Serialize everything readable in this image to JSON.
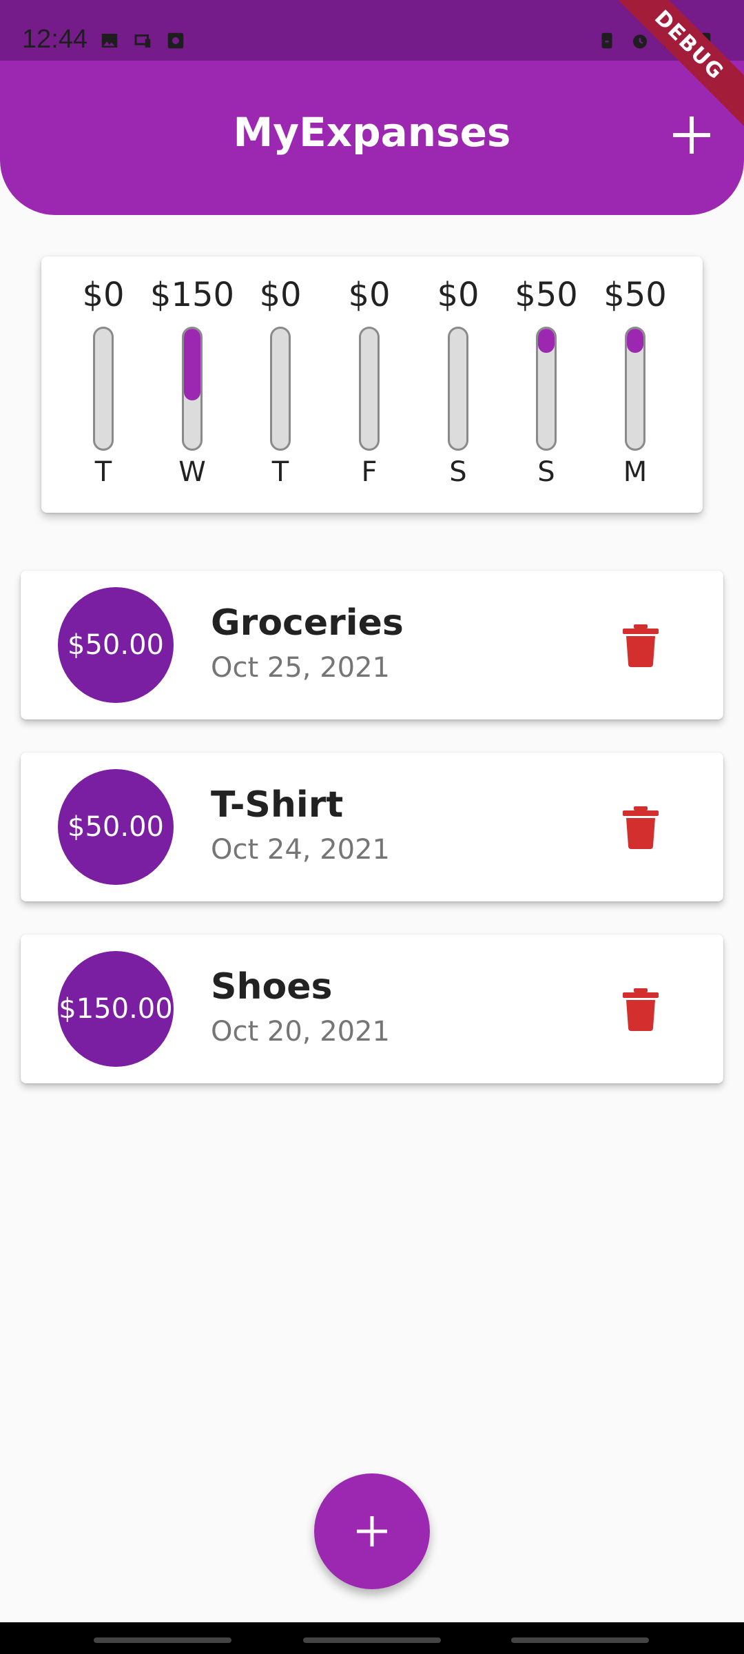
{
  "status_bar": {
    "time": "12:44",
    "left_icons": [
      "image-icon",
      "devices-icon",
      "media-icon"
    ],
    "right_icons": [
      "battery-saver-icon",
      "alarm-icon",
      "network-icon",
      "battery-icon"
    ],
    "debug_label": "DEBUG"
  },
  "app_bar": {
    "title": "MyExpanses",
    "add_icon": "plus-icon"
  },
  "chart": {
    "days": [
      {
        "day": "T",
        "amount": "$0",
        "fraction": 0
      },
      {
        "day": "W",
        "amount": "$150",
        "fraction": 0.6
      },
      {
        "day": "T",
        "amount": "$0",
        "fraction": 0
      },
      {
        "day": "F",
        "amount": "$0",
        "fraction": 0
      },
      {
        "day": "S",
        "amount": "$0",
        "fraction": 0
      },
      {
        "day": "S",
        "amount": "$50",
        "fraction": 0.2
      },
      {
        "day": "M",
        "amount": "$50",
        "fraction": 0.2
      }
    ]
  },
  "transactions": [
    {
      "amount": "$50.00",
      "title": "Groceries",
      "date": "Oct 25, 2021"
    },
    {
      "amount": "$50.00",
      "title": "T-Shirt",
      "date": "Oct 24, 2021"
    },
    {
      "amount": "$150.00",
      "title": "Shoes",
      "date": "Oct 20, 2021"
    }
  ],
  "colors": {
    "primary": "#9c27b0",
    "primary_dark": "#7b1fa2",
    "delete": "#d32f2f",
    "background": "#fafafa"
  },
  "fab": {
    "icon": "plus-icon"
  }
}
